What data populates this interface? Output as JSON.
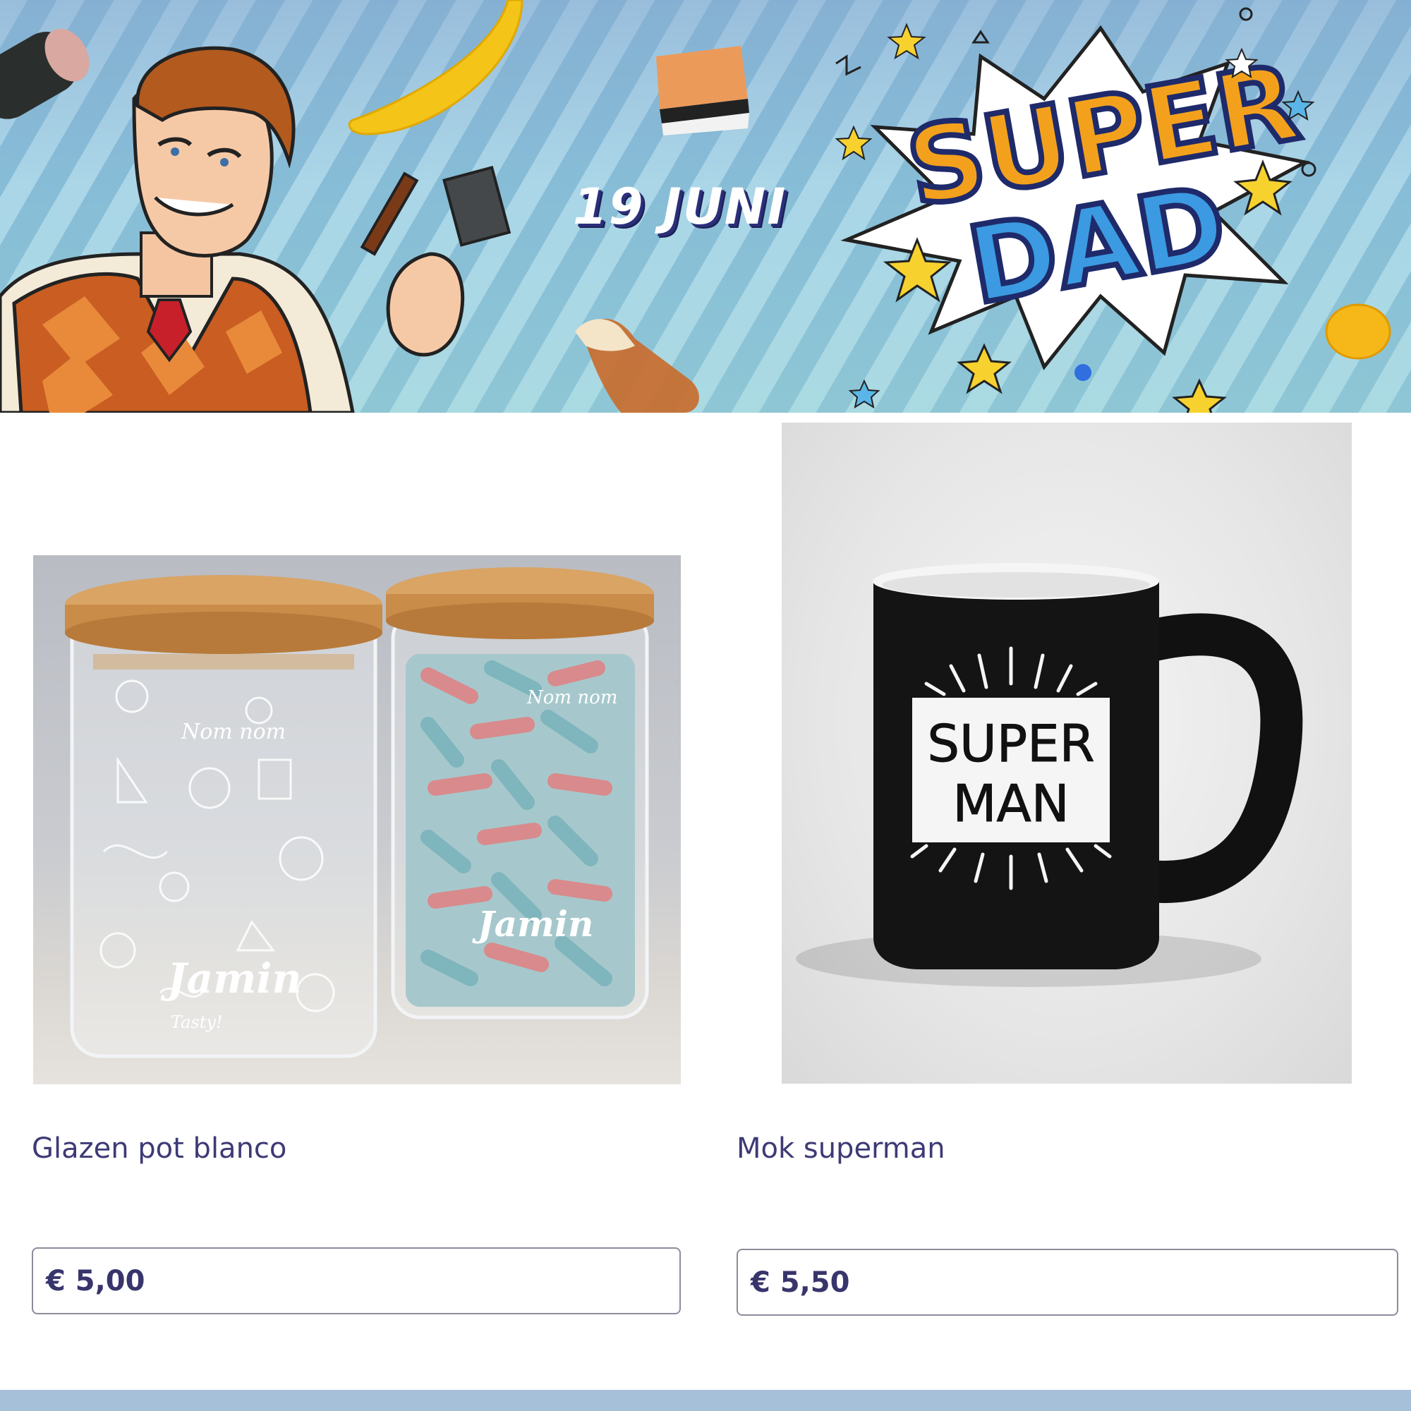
{
  "banner": {
    "date_text": "19 JUNI",
    "headline_line1": "SUPER",
    "headline_line2": "DAD"
  },
  "products": [
    {
      "title": "Glazen pot blanco",
      "price": "€ 5,00",
      "image": "glass-jars-photo",
      "jar_labels": [
        "Nom nom",
        "Jamin",
        "Tasty!"
      ]
    },
    {
      "title": "Mok superman",
      "price": "€ 5,50",
      "image": "black-mug-photo",
      "mug_text_line1": "SUPER",
      "mug_text_line2": "MAN"
    }
  ],
  "colors": {
    "title_text": "#3d3a76",
    "price_text": "#38356c",
    "price_border": "#8e8c9b",
    "footer_bar": "#a7c0da"
  }
}
